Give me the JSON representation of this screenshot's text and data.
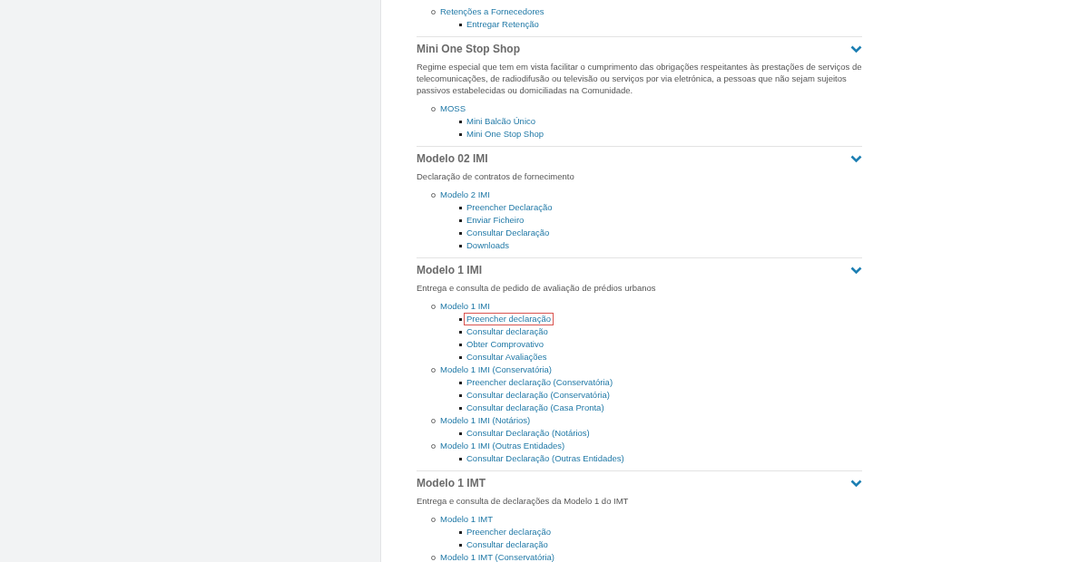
{
  "sections": [
    {
      "groups": [
        {
          "label": "Retenções a Fornecedores",
          "items": [
            {
              "label": "Entregar Retenção",
              "highlighted": false
            }
          ]
        }
      ]
    },
    {
      "title": "Mini One Stop Shop",
      "description": "Regime especial que tem em vista facilitar o cumprimento das obrigações respeitantes às prestações de serviços de telecomunicações, de radiodifusão ou televisão ou serviços por via eletrónica, a pessoas que não sejam sujeitos passivos estabelecidas ou domiciliadas na Comunidade.",
      "groups": [
        {
          "label": "MOSS",
          "items": [
            {
              "label": "Mini Balcão Único",
              "highlighted": false
            },
            {
              "label": "Mini One Stop Shop",
              "highlighted": false
            }
          ]
        }
      ]
    },
    {
      "title": "Modelo 02 IMI",
      "description": "Declaração de contratos de fornecimento",
      "groups": [
        {
          "label": "Modelo 2 IMI",
          "items": [
            {
              "label": "Preencher Declaração",
              "highlighted": false
            },
            {
              "label": "Enviar Ficheiro",
              "highlighted": false
            },
            {
              "label": "Consultar Declaração",
              "highlighted": false
            },
            {
              "label": "Downloads",
              "highlighted": false
            }
          ]
        }
      ]
    },
    {
      "title": "Modelo 1 IMI",
      "description": "Entrega e consulta de pedido de avaliação de prédios urbanos",
      "groups": [
        {
          "label": "Modelo 1 IMI",
          "items": [
            {
              "label": "Preencher declaração",
              "highlighted": true
            },
            {
              "label": "Consultar declaração",
              "highlighted": false
            },
            {
              "label": "Obter Comprovativo",
              "highlighted": false
            },
            {
              "label": "Consultar Avaliações",
              "highlighted": false
            }
          ]
        },
        {
          "label": "Modelo 1 IMI (Conservatória)",
          "items": [
            {
              "label": "Preencher declaração (Conservatória)",
              "highlighted": false
            },
            {
              "label": "Consultar declaração (Conservatória)",
              "highlighted": false
            },
            {
              "label": "Consultar declaração (Casa Pronta)",
              "highlighted": false
            }
          ]
        },
        {
          "label": "Modelo 1 IMI (Notários)",
          "items": [
            {
              "label": "Consultar Declaração (Notários)",
              "highlighted": false
            }
          ]
        },
        {
          "label": "Modelo 1 IMI (Outras Entidades)",
          "items": [
            {
              "label": "Consultar Declaração (Outras Entidades)",
              "highlighted": false
            }
          ]
        }
      ]
    },
    {
      "title": "Modelo 1 IMT",
      "description": "Entrega e consulta de declarações da Modelo 1 do IMT",
      "groups": [
        {
          "label": "Modelo 1 IMT",
          "items": [
            {
              "label": "Preencher declaração",
              "highlighted": false
            },
            {
              "label": "Consultar declaração",
              "highlighted": false
            }
          ]
        },
        {
          "label": "Modelo 1 IMT (Conservatória)"
        }
      ]
    }
  ]
}
